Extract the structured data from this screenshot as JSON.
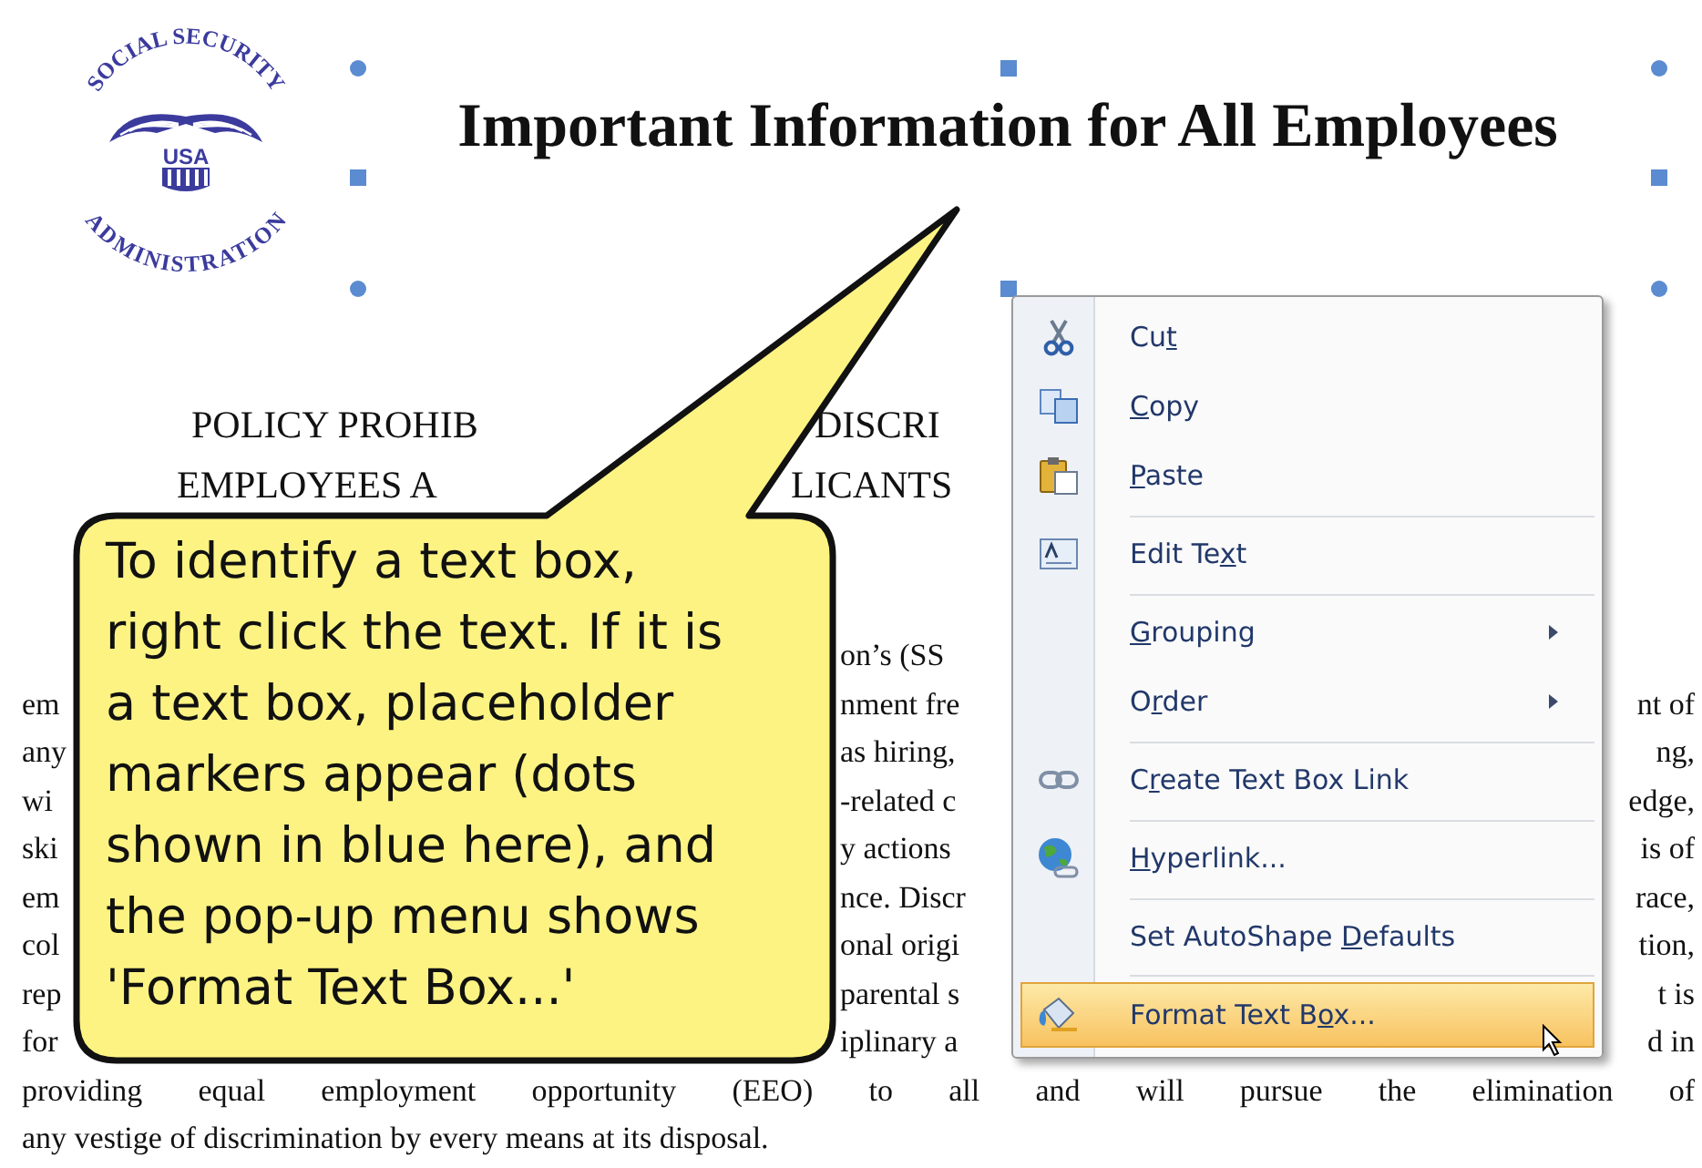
{
  "logo": {
    "ring_top": "SOCIAL SECURITY",
    "ring_bottom": "ADMINISTRATION",
    "center": "USA"
  },
  "title_box": {
    "text": "Important Information for All Employees",
    "selected": true
  },
  "heading_lines": [
    {
      "left": "POLICY PROHIB",
      "right": "DISCRI"
    },
    {
      "left": "EMPLOYEES A",
      "right": "LICANTS"
    }
  ],
  "body_lines": [
    {
      "kind": "covered",
      "middle": "on’s (SS"
    },
    {
      "kind": "covered",
      "left": "em",
      "middle": "nment fre",
      "right": "nt of"
    },
    {
      "kind": "covered",
      "left": "any",
      "middle": "as hiring,",
      "right": "ng,"
    },
    {
      "kind": "covered",
      "left": "wi",
      "middle": "-related c",
      "right": "edge,"
    },
    {
      "kind": "covered",
      "left": "ski",
      "middle": "y actions",
      "right": "is of"
    },
    {
      "kind": "covered",
      "left": "em",
      "middle": "nce. Discr",
      "right": "race,"
    },
    {
      "kind": "covered",
      "left": "col",
      "middle": "onal origi",
      "right": "tion,"
    },
    {
      "kind": "covered",
      "left": "rep",
      "middle": "parental s",
      "right": "t is"
    },
    {
      "kind": "covered",
      "left": "for",
      "middle": "iplinary a",
      "right": "d in"
    },
    {
      "kind": "full",
      "text": "providing equal employment opportunity (EEO) to all and will pursue the elimination  of",
      "justified": true
    },
    {
      "kind": "full",
      "text": "any vestige of discrimination  by every means at its disposal.",
      "justified": false
    }
  ],
  "callout": {
    "text": "To identify a text box, right click the text. If it is a text box, placeholder markers appear (dots shown in blue here), and the pop-up menu shows 'Format Text Box...'"
  },
  "context_menu": {
    "items": [
      {
        "label": {
          "pre": "Cu",
          "key": "t"
        },
        "submenu": false,
        "separator_before": false,
        "selected": false
      },
      {
        "label": {
          "key": "C",
          "post": "opy"
        },
        "submenu": false,
        "separator_before": false,
        "selected": false
      },
      {
        "label": {
          "key": "P",
          "post": "aste"
        },
        "submenu": false,
        "separator_before": false,
        "selected": false
      },
      {
        "label": {
          "pre": "Edit Te",
          "key": "x",
          "post": "t"
        },
        "submenu": false,
        "separator_before": true,
        "selected": false
      },
      {
        "label": {
          "key": "G",
          "post": "rouping"
        },
        "submenu": true,
        "separator_before": true,
        "selected": false
      },
      {
        "label": {
          "pre": "O",
          "key": "r",
          "post": "der"
        },
        "submenu": true,
        "separator_before": false,
        "selected": false
      },
      {
        "label": {
          "pre": "C",
          "key": "r",
          "post": "eate Text Box Link"
        },
        "submenu": false,
        "separator_before": true,
        "selected": false
      },
      {
        "label": {
          "key": "H",
          "post": "yperlink..."
        },
        "submenu": false,
        "separator_before": true,
        "selected": false
      },
      {
        "label": {
          "pre": "Set AutoShape ",
          "key": "D",
          "post": "efaults"
        },
        "submenu": false,
        "separator_before": true,
        "selected": false
      },
      {
        "label": {
          "pre": "Format Text B",
          "key": "o",
          "post": "x..."
        },
        "submenu": false,
        "separator_before": true,
        "selected": true
      }
    ]
  }
}
